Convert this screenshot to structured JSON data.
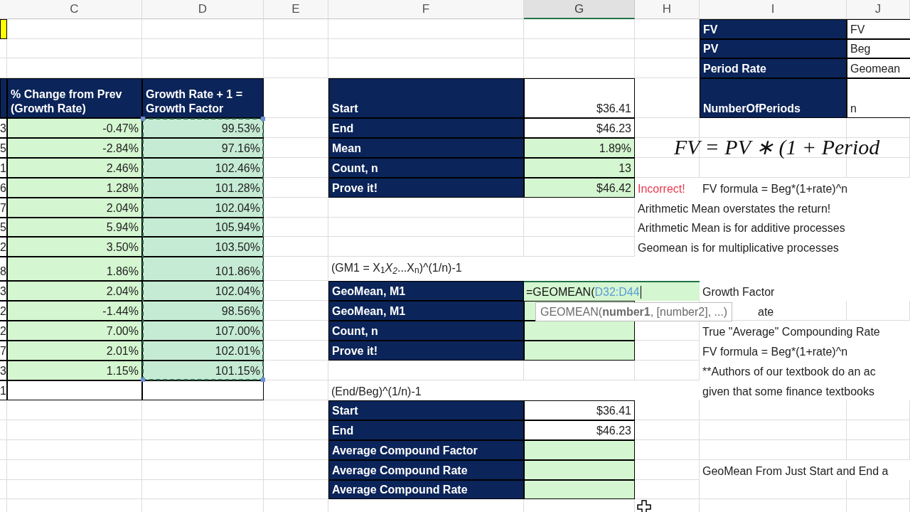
{
  "columns": [
    {
      "label": "C",
      "selected": false
    },
    {
      "label": "D",
      "selected": false
    },
    {
      "label": "E",
      "selected": false
    },
    {
      "label": "F",
      "selected": false
    },
    {
      "label": "G",
      "selected": true
    },
    {
      "label": "H",
      "selected": false
    },
    {
      "label": "I",
      "selected": false
    },
    {
      "label": "J",
      "selected": false
    }
  ],
  "rows": [
    {
      "B": {
        "kind": "yellow"
      },
      "I": {
        "kind": "label",
        "text": "FV"
      },
      "J": {
        "kind": "boxed-text",
        "text": "FV"
      }
    },
    {
      "I": {
        "kind": "label",
        "text": "PV"
      },
      "J": {
        "kind": "boxed-text",
        "text": "Beg"
      }
    },
    {
      "I": {
        "kind": "label",
        "text": "Period Rate"
      },
      "J": {
        "kind": "boxed-text",
        "text": "Geomean"
      }
    },
    {
      "B": {
        "kind": "label"
      },
      "C": {
        "kind": "header",
        "text": "% Change from Prev\n(Growth Rate)"
      },
      "D": {
        "kind": "header",
        "text": "Growth Rate + 1 =\nGrowth Factor"
      },
      "F": {
        "kind": "label",
        "text": "Start"
      },
      "G": {
        "kind": "value",
        "text": "$36.41"
      },
      "I": {
        "kind": "label",
        "text": "NumberOfPeriods"
      },
      "J": {
        "kind": "boxed-text",
        "text": "n"
      }
    },
    {
      "B": {
        "kind": "clipped",
        "text": "3"
      },
      "C": {
        "kind": "green",
        "text": "-0.47%",
        "highlighted": false
      },
      "D": {
        "kind": "green",
        "text": "99.53%",
        "highlighted": true
      },
      "F": {
        "kind": "label",
        "text": "End"
      },
      "G": {
        "kind": "value",
        "text": "$46.23"
      }
    },
    {
      "B": {
        "kind": "clipped",
        "text": "5"
      },
      "C": {
        "kind": "green",
        "text": "-2.84%",
        "highlighted": false
      },
      "D": {
        "kind": "green",
        "text": "97.16%",
        "highlighted": true
      },
      "F": {
        "kind": "label",
        "text": "Mean"
      },
      "G": {
        "kind": "green",
        "text": "1.89%",
        "highlighted": false
      },
      "H": {
        "kind": "equation",
        "text": "FV = PV ∗ (1 + Period"
      }
    },
    {
      "B": {
        "kind": "clipped",
        "text": "1"
      },
      "C": {
        "kind": "green",
        "text": "2.46%",
        "highlighted": false
      },
      "D": {
        "kind": "green",
        "text": "102.46%",
        "highlighted": true
      },
      "F": {
        "kind": "label",
        "text": "Count, n"
      },
      "G": {
        "kind": "green",
        "text": "13",
        "highlighted": false
      }
    },
    {
      "B": {
        "kind": "clipped",
        "text": "6"
      },
      "C": {
        "kind": "green",
        "text": "1.28%",
        "highlighted": false
      },
      "D": {
        "kind": "green",
        "text": "101.28%",
        "highlighted": true
      },
      "F": {
        "kind": "label",
        "text": "Prove it!"
      },
      "G": {
        "kind": "green",
        "text": "$46.42",
        "highlighted": false
      },
      "H": {
        "kind": "warning",
        "text": "Incorrect!"
      },
      "I": {
        "kind": "note",
        "text": "FV formula = Beg*(1+rate)^n"
      }
    },
    {
      "B": {
        "kind": "clipped",
        "text": "7"
      },
      "C": {
        "kind": "green",
        "text": "2.04%",
        "highlighted": false
      },
      "D": {
        "kind": "green",
        "text": "102.04%",
        "highlighted": true
      },
      "H": {
        "kind": "note",
        "text": "Arithmetic Mean overstates the return!"
      }
    },
    {
      "B": {
        "kind": "clipped",
        "text": "5"
      },
      "C": {
        "kind": "green",
        "text": "5.94%",
        "highlighted": false
      },
      "D": {
        "kind": "green",
        "text": "105.94%",
        "highlighted": true
      },
      "H": {
        "kind": "note",
        "text": "Arithmetic Mean is for additive processes"
      }
    },
    {
      "B": {
        "kind": "clipped",
        "text": "2"
      },
      "C": {
        "kind": "green",
        "text": "3.50%",
        "highlighted": false
      },
      "D": {
        "kind": "green",
        "text": "103.50%",
        "highlighted": true
      },
      "H": {
        "kind": "note",
        "text": "Geomean is for multiplicative processes"
      }
    },
    {
      "B": {
        "kind": "clipped",
        "text": "8"
      },
      "C": {
        "kind": "green",
        "text": "1.86%",
        "highlighted": false
      },
      "D": {
        "kind": "green",
        "text": "101.86%",
        "highlighted": true
      },
      "F": {
        "kind": "math-note",
        "text": "(GM1 = X$_{1}$*X$_{2}$*...X$_{n}$)^(1/n)-1"
      }
    },
    {
      "B": {
        "kind": "clipped",
        "text": "3"
      },
      "C": {
        "kind": "green",
        "text": "2.04%",
        "highlighted": false
      },
      "D": {
        "kind": "green",
        "text": "102.04%",
        "highlighted": true
      },
      "F": {
        "kind": "label",
        "text": "GeoMean, M1"
      },
      "G": {
        "kind": "editing",
        "text": "=GEOMEAN(",
        "reference": "D32:D44"
      },
      "I": {
        "kind": "note",
        "text": "Growth Factor"
      }
    },
    {
      "B": {
        "kind": "clipped",
        "text": "2"
      },
      "C": {
        "kind": "green",
        "text": "-1.44%",
        "highlighted": false
      },
      "D": {
        "kind": "green",
        "text": "98.56%",
        "highlighted": true
      },
      "F": {
        "kind": "label",
        "text": "GeoMean, M1"
      },
      "G": {
        "kind": "green",
        "highlighted": false
      },
      "I": {
        "kind": "covered-note",
        "text": "ate"
      }
    },
    {
      "B": {
        "kind": "clipped",
        "text": "2"
      },
      "C": {
        "kind": "green",
        "text": "7.00%",
        "highlighted": false
      },
      "D": {
        "kind": "green",
        "text": "107.00%",
        "highlighted": true
      },
      "F": {
        "kind": "label",
        "text": "Count, n"
      },
      "G": {
        "kind": "green",
        "highlighted": false
      },
      "I": {
        "kind": "note",
        "text": "True \"Average\" Compounding Rate"
      }
    },
    {
      "B": {
        "kind": "clipped",
        "text": "7"
      },
      "C": {
        "kind": "green",
        "text": "2.01%",
        "highlighted": false
      },
      "D": {
        "kind": "green",
        "text": "102.01%",
        "highlighted": true
      },
      "F": {
        "kind": "label",
        "text": "Prove it!"
      },
      "G": {
        "kind": "green",
        "highlighted": false
      },
      "I": {
        "kind": "note",
        "text": "FV formula = Beg*(1+rate)^n"
      }
    },
    {
      "B": {
        "kind": "clipped",
        "text": "3"
      },
      "C": {
        "kind": "green",
        "text": "1.15%",
        "highlighted": false
      },
      "D": {
        "kind": "green",
        "text": "101.15%",
        "highlighted": true
      },
      "I": {
        "kind": "note",
        "text": "**Authors of our textbook do an ac"
      }
    },
    {
      "B": {
        "kind": "clipped",
        "text": "1"
      },
      "C": {
        "kind": "boxed"
      },
      "D": {
        "kind": "boxed"
      },
      "F": {
        "kind": "note",
        "text": "(End/Beg)^(1/n)-1"
      },
      "I": {
        "kind": "note",
        "text": "given that some finance textbooks"
      }
    },
    {
      "F": {
        "kind": "label",
        "text": "Start"
      },
      "G": {
        "kind": "value",
        "text": "$36.41"
      }
    },
    {
      "F": {
        "kind": "label",
        "text": "End"
      },
      "G": {
        "kind": "value",
        "text": "$46.23"
      }
    },
    {
      "F": {
        "kind": "label",
        "text": "Average Compound Factor"
      },
      "G": {
        "kind": "green",
        "highlighted": false
      }
    },
    {
      "F": {
        "kind": "label",
        "text": "Average Compound Rate"
      },
      "G": {
        "kind": "green",
        "highlighted": false
      },
      "I": {
        "kind": "note",
        "text": "GeoMean From Just Start and End a"
      }
    },
    {
      "F": {
        "kind": "label",
        "text": "Average Compound Rate"
      },
      "G": {
        "kind": "green",
        "highlighted": false
      }
    }
  ],
  "tooltip": {
    "text": "GEOMEAN(**number1**, [number2], ...)"
  }
}
